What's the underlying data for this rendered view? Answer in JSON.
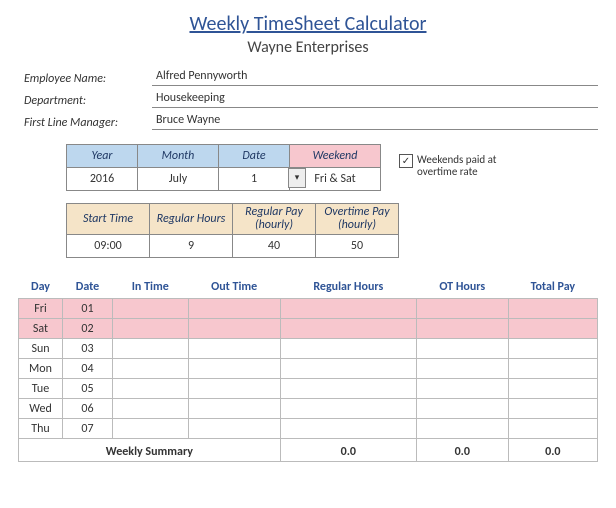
{
  "header": {
    "title": "Weekly TimeSheet Calculator",
    "company": "Wayne Enterprises"
  },
  "employee": {
    "name_label": "Employee Name:",
    "name": "Alfred Pennyworth",
    "dept_label": "Department:",
    "dept": "Housekeeping",
    "mgr_label": "First Line Manager:",
    "mgr": "Bruce Wayne"
  },
  "period": {
    "year_label": "Year",
    "year": "2016",
    "month_label": "Month",
    "month": "July",
    "date_label": "Date",
    "date": "1",
    "weekend_label": "Weekend",
    "weekend": "Fri & Sat"
  },
  "option": {
    "checked": "✓",
    "label": "Weekends paid at overtime rate"
  },
  "pay": {
    "start_label": "Start Time",
    "start": "09:00",
    "reg_hours_label": "Regular Hours",
    "reg_hours": "9",
    "reg_pay_label": "Regular Pay (hourly)",
    "reg_pay": "40",
    "ot_pay_label": "Overtime Pay (hourly)",
    "ot_pay": "50"
  },
  "columns": {
    "day": "Day",
    "date": "Date",
    "in": "In Time",
    "out": "Out Time",
    "reg": "Regular Hours",
    "ot": "OT Hours",
    "total": "Total Pay"
  },
  "rows": [
    {
      "day": "Fri",
      "date": "01",
      "weekend": true
    },
    {
      "day": "Sat",
      "date": "02",
      "weekend": true
    },
    {
      "day": "Sun",
      "date": "03",
      "weekend": false
    },
    {
      "day": "Mon",
      "date": "04",
      "weekend": false
    },
    {
      "day": "Tue",
      "date": "05",
      "weekend": false
    },
    {
      "day": "Wed",
      "date": "06",
      "weekend": false
    },
    {
      "day": "Thu",
      "date": "07",
      "weekend": false
    }
  ],
  "summary": {
    "label": "Weekly Summary",
    "reg": "0.0",
    "ot": "0.0",
    "total": "0.0"
  }
}
